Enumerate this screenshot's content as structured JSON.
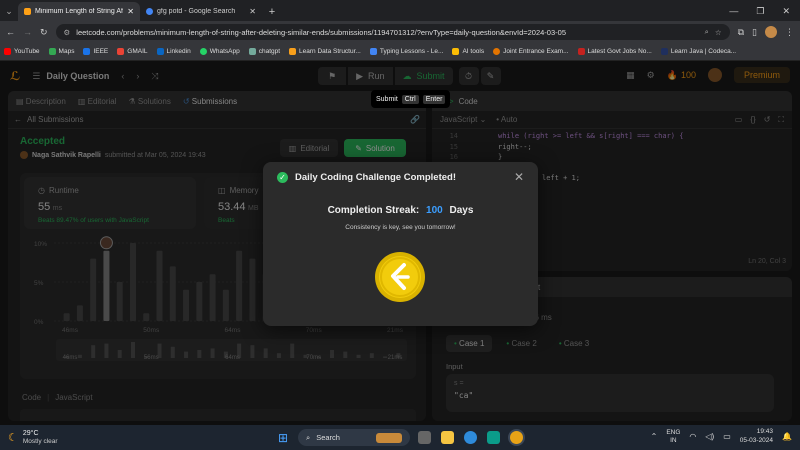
{
  "browser": {
    "tabs": [
      {
        "title": "Minimum Length of String After",
        "active": true
      },
      {
        "title": "gfg potd - Google Search",
        "active": false
      }
    ],
    "url": "leetcode.com/problems/minimum-length-of-string-after-deleting-similar-ends/submissions/1194701312/?envType=daily-question&envId=2024-03-05",
    "bookmarks": [
      "YouTube",
      "Maps",
      "IEEE",
      "GMAIL",
      "Linkedin",
      "WhatsApp",
      "chatgpt",
      "Learn Data Structur...",
      "Typing Lessons - Le...",
      "AI tools",
      "Joint Entrance Exam...",
      "Latest Govt Jobs No...",
      "Learn Java | Codeca..."
    ],
    "bookmark_colors": [
      "#ff0000",
      "#34a853",
      "#1a73e8",
      "#ea4335",
      "#0a66c2",
      "#25d366",
      "#74aa9c",
      "#f89f1b",
      "#4285f4",
      "#fbbc04",
      "#e37400",
      "#c5221f",
      "#1f2f5e"
    ]
  },
  "lc_nav": {
    "daily_question": "Daily Question",
    "run": "Run",
    "submit": "Submit",
    "coins": "100",
    "premium": "Premium"
  },
  "tooltip": {
    "label": "Submit",
    "key1": "Ctrl",
    "key2": "Enter"
  },
  "left_tabs": [
    "Description",
    "Editorial",
    "Solutions",
    "Submissions"
  ],
  "all_submissions": "All Submissions",
  "submission": {
    "status": "Accepted",
    "user": "Naga Sathvik Rapelli",
    "submitted_at": "submitted at Mar 05, 2024 19:43",
    "editorial_btn": "Editorial",
    "solution_btn": "Solution",
    "runtime_label": "Runtime",
    "runtime_value": "55",
    "runtime_unit": "ms",
    "runtime_beats": "Beats 89.47% of users with JavaScript",
    "memory_label": "Memory",
    "memory_value": "53.44",
    "memory_unit": "MB",
    "memory_beats": "Beats"
  },
  "chart_data": {
    "type": "bar",
    "y_ticks": [
      "10%",
      "5%",
      "0%"
    ],
    "x_ticks": [
      "46ms",
      "50ms",
      "64ms",
      "70ms",
      "21ms"
    ],
    "values": [
      1,
      2,
      8,
      9,
      5,
      10,
      1,
      9,
      7,
      4,
      5,
      6,
      4,
      9,
      8,
      6,
      3,
      9,
      2,
      1,
      5,
      4,
      2,
      3,
      1,
      3
    ],
    "ylim": [
      0,
      10
    ],
    "highlight_index": 3,
    "mini_ticks": [
      "46ms",
      "56ms",
      "64ms",
      "70ms",
      "21ms"
    ]
  },
  "code_section": {
    "label": "Code",
    "lang": "JavaScript"
  },
  "editor": {
    "header": "Code",
    "lang": "JavaScript",
    "auto": "Auto",
    "lines": [
      {
        "num": "14",
        "text": "while (right >= left && s[right] === char) {"
      },
      {
        "num": "15",
        "text": "    right--;"
      },
      {
        "num": "16",
        "text": "}"
      },
      {
        "num": "",
        "text": ""
      },
      {
        "num": "",
        "text": "left + 1;"
      }
    ],
    "position": "Ln 20, Col 3"
  },
  "testresult": {
    "header": "t",
    "runtime": "36 ms",
    "cases": [
      "Case 1",
      "Case 2",
      "Case 3"
    ],
    "input_label": "Input",
    "var_name": "s =",
    "var_value": "\"ca\""
  },
  "modal": {
    "title": "Daily Coding Challenge Completed!",
    "streak_label": "Completion Streak:",
    "streak_value": "100",
    "streak_unit": "Days",
    "subtitle": "Consistency is key, see you tomorrow!"
  },
  "taskbar": {
    "weather_temp": "29°C",
    "weather_desc": "Mostly clear",
    "search": "Search",
    "lang1": "ENG",
    "lang2": "IN",
    "time": "19:43",
    "date": "05-03-2024"
  }
}
